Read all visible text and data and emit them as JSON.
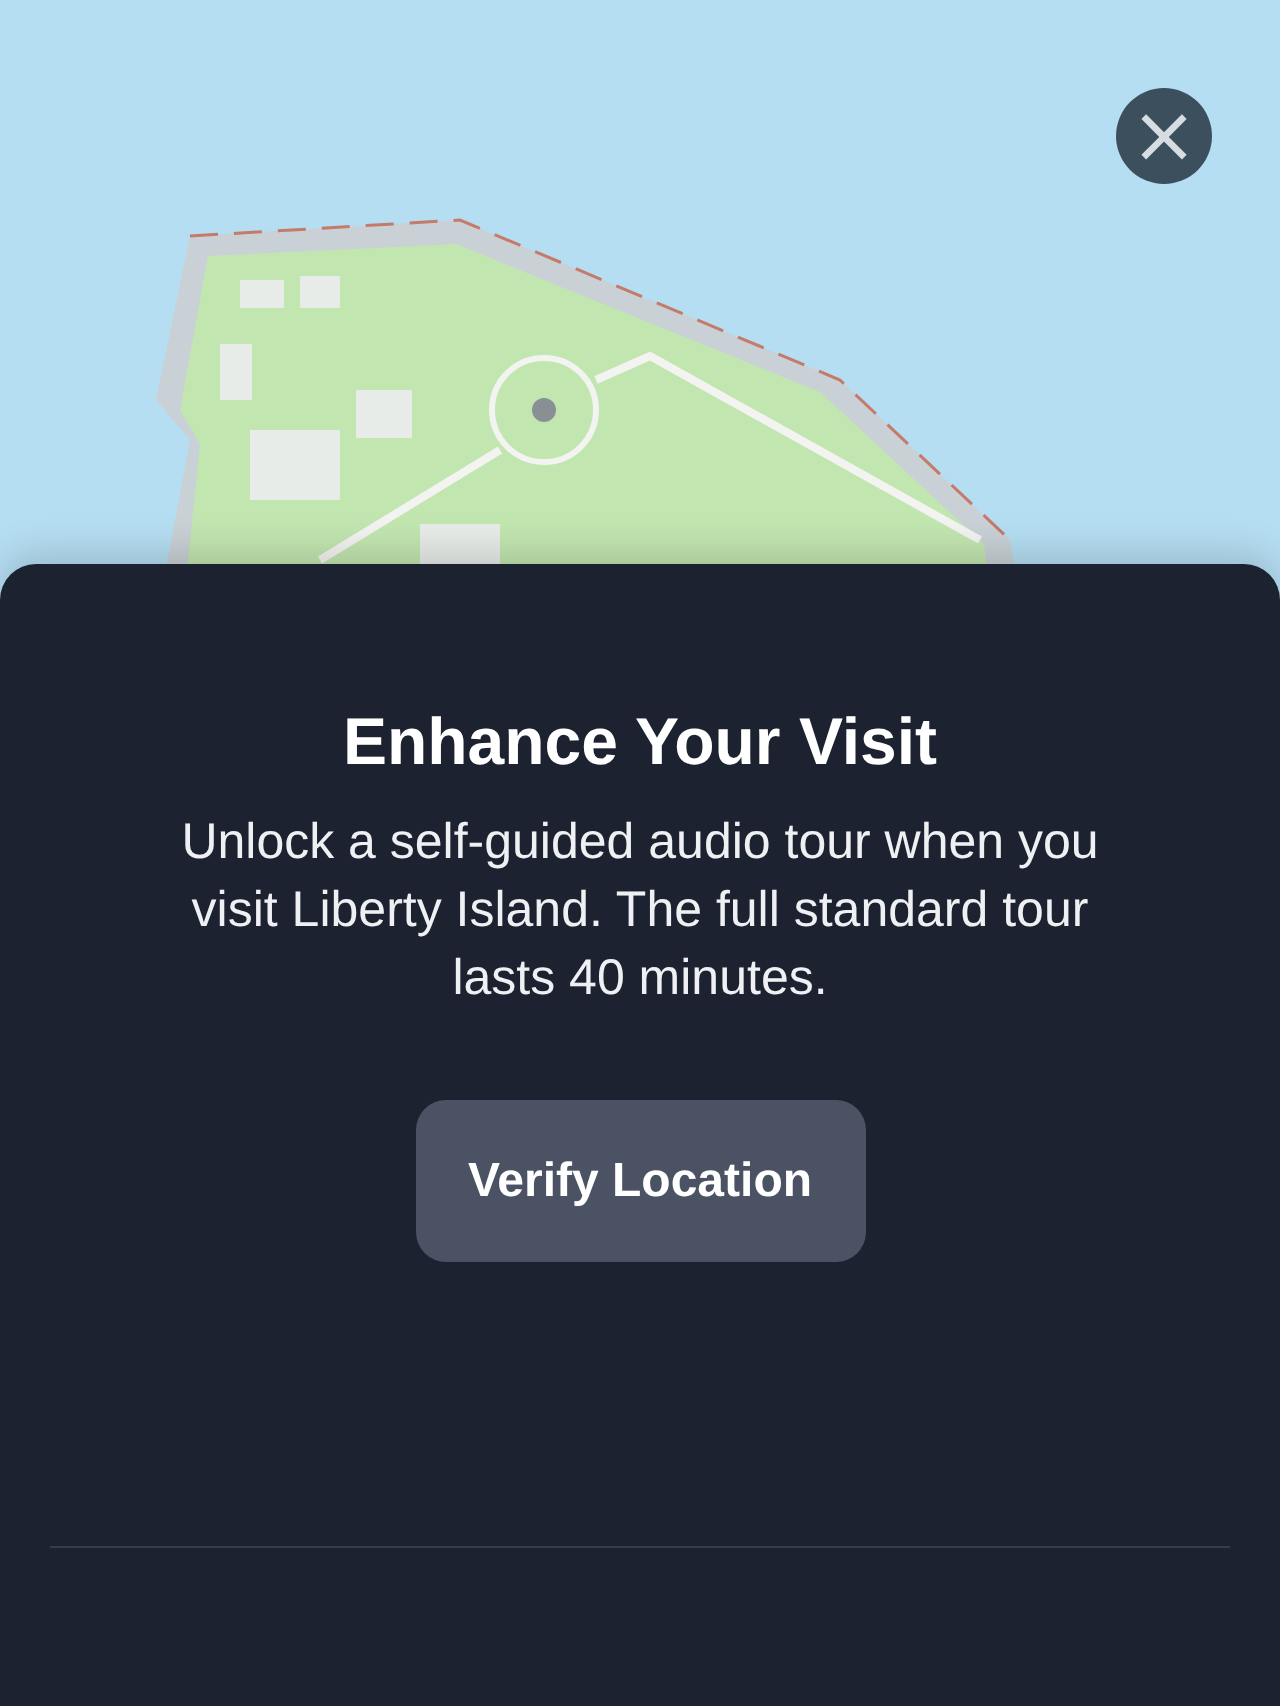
{
  "close_button": {
    "label": "×"
  },
  "sheet": {
    "title": "Enhance Your Visit",
    "description": "Unlock a self-guided audio tour when you visit Liberty Island. The full standard tour lasts 40 minutes.",
    "button": "Verify Location"
  }
}
